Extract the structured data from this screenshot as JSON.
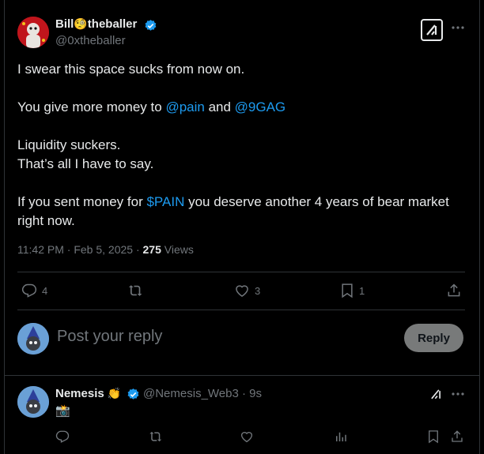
{
  "colors": {
    "accent": "#1d9bf0",
    "muted": "#71767b",
    "text": "#e7e9ea",
    "border": "#2f3336"
  },
  "post": {
    "author_name_left": "Bill",
    "author_emoji": "🧐",
    "author_name_right": "theballer",
    "author_handle": "@0xtheballer",
    "lines": {
      "l1": "I swear this space sucks from now on.",
      "l2_pre": "You give more money to ",
      "l2_link1": "@pain",
      "l2_mid": " and ",
      "l2_link2": "@9GAG",
      "l3": "Liquidity suckers.",
      "l4": "That’s all I have to say.",
      "l5_pre": "If you sent money for ",
      "l5_link": "$PAIN",
      "l5_post": " you deserve another 4 years of bear market right now."
    },
    "time": "11:42 PM · Feb 5, 2025 · ",
    "views_count": "275",
    "views_label": " Views",
    "replies": "4",
    "likes": "3",
    "bookmarks": "1"
  },
  "composer": {
    "placeholder": "Post your reply",
    "reply_button": "Reply"
  },
  "reply": {
    "author_name": "Nemesis",
    "author_emoji": "👏",
    "handle_time": "@Nemesis_Web3 · 9s",
    "text_emoji": "📸"
  },
  "icons": [
    "verified-icon",
    "grok-icon",
    "more-icon",
    "reply-icon",
    "repost-icon",
    "like-icon",
    "bookmark-icon",
    "share-icon",
    "views-icon"
  ]
}
